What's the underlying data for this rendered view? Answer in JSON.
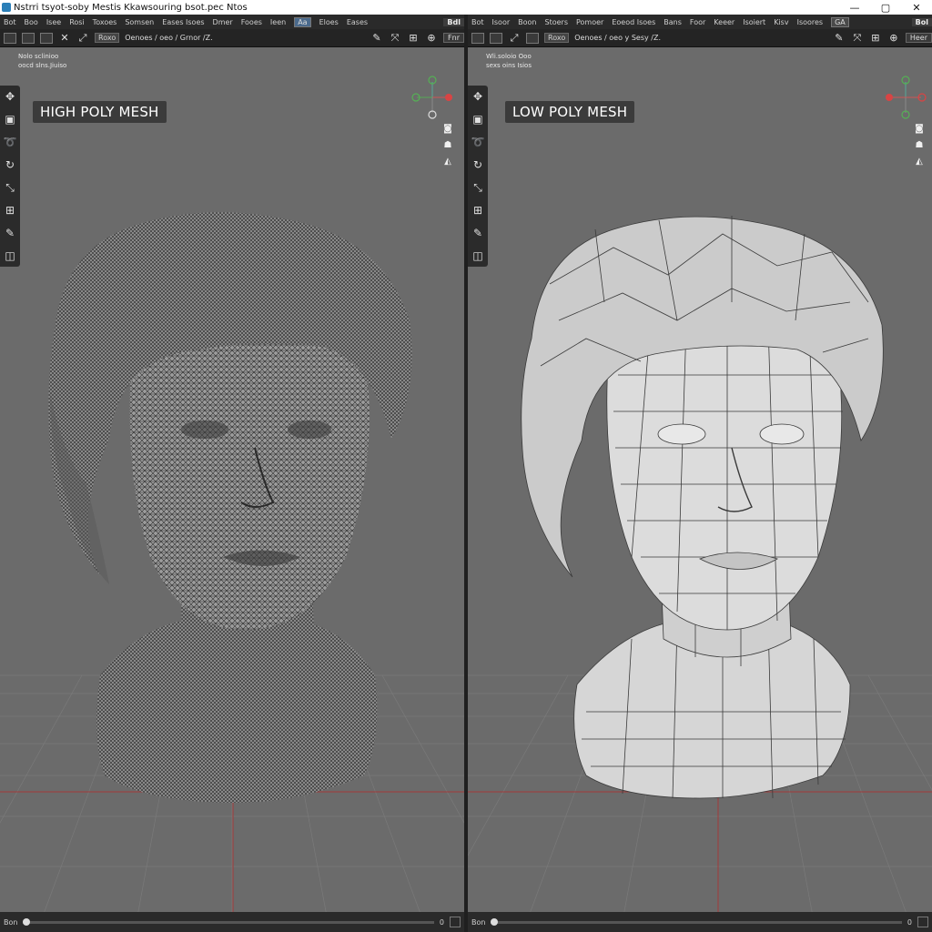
{
  "window": {
    "title": "Nstrri tsyot-soby Mestis Kkawsouring bsot.pec Ntos",
    "controls": {
      "minimize": "—",
      "maximize": "▢",
      "close": "✕"
    }
  },
  "left": {
    "menu": [
      "Bot",
      "Boo",
      "Isee",
      "Rosi",
      "Toxoes",
      "Somsen",
      "Eases Isoes",
      "Dmer",
      "Fooes",
      "Ieen",
      "Eloes",
      "Eases"
    ],
    "menu_box": "Aa",
    "menu_corner": "Bdl",
    "toolbar_label": "Roxo",
    "toolbar_text": "Oenoes / oeo / Grnor /Z.",
    "toolbar_dd": "Fnr",
    "info_lines": [
      "Nolo sclinioo",
      "oocd slns.Jiuiso"
    ],
    "mesh_label": "HIGH POLY MESH",
    "frame_start": "Bon",
    "frame_end": "0"
  },
  "right": {
    "menu": [
      "Bot",
      "Isoor",
      "Boon",
      "Stoers",
      "Pomoer",
      "Eoeod Isoes",
      "Bans",
      "Foor",
      "Keeer",
      "Isoiert",
      "Kisv",
      "Isoores"
    ],
    "menu_box": "GA",
    "menu_corner": "Bol",
    "toolbar_label": "Roxo",
    "toolbar_text": "Oenoes / oeo y Sesy /Z.",
    "toolbar_dd": "Heer",
    "info_lines": [
      "Wli.soloio Ooo",
      "sexs oins Isios"
    ],
    "mesh_label": "LOW POLY MESH",
    "frame_start": "Bon",
    "frame_end": "0"
  },
  "colors": {
    "viewport_bg": "#6b6b6b",
    "grid_line": "#7a7a7a",
    "x_axis": "#a33a3a",
    "gizmo_x": "#d94444",
    "gizmo_y": "#55b055",
    "gizmo_z": "#5588dd"
  },
  "icons": {
    "tools": [
      "move-icon",
      "select-box-icon",
      "lasso-icon",
      "rotate-icon",
      "scale-icon",
      "transform-icon",
      "annotate-icon",
      "measure-icon"
    ],
    "view": [
      "camera-icon",
      "light-icon",
      "shading-icon"
    ]
  }
}
